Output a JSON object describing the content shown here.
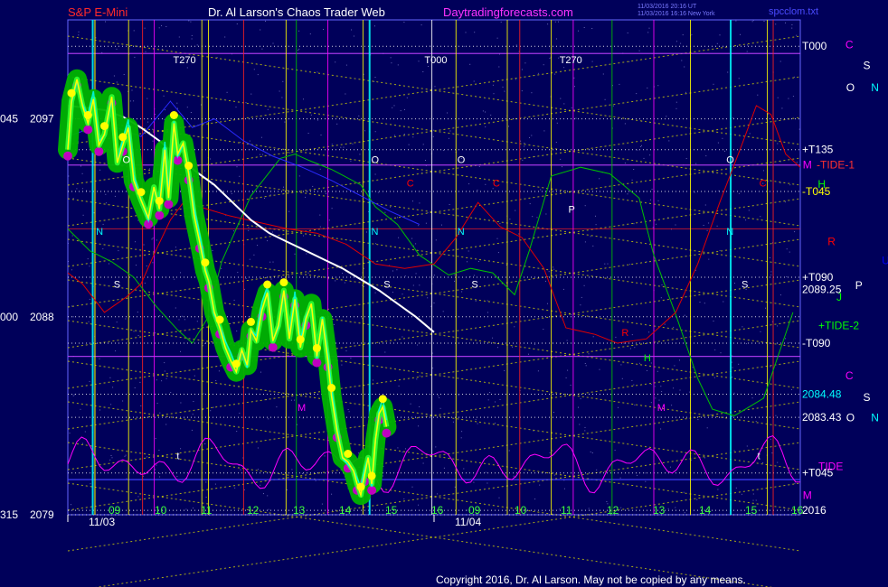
{
  "header": {
    "instrument": "S&P E-Mini",
    "site": "Dr. Al Larson's Chaos Trader Web",
    "link": "Daytradingforecasts.com",
    "timestamp_1": "11/03/2016 20:16 UT",
    "timestamp_2": "11/03/2016 16:16 New York",
    "filename": "spcclom.txt"
  },
  "footer": {
    "copyright": "Copyright 2016, Dr. Al Larson. May not be copied by any means."
  },
  "colors": {
    "background": "#00005a",
    "price": "#ffff00",
    "ribbon": "#00c800",
    "magenta": "#ff00ff",
    "cyan": "#00ffff",
    "white": "#ffffff",
    "red": "#e00000",
    "green": "#00c000"
  },
  "chart_data": {
    "type": "line",
    "title": "S&P E-Mini",
    "y_left_labels": [
      {
        "code": "045",
        "value": "2097"
      },
      {
        "code": "000",
        "value": "2088"
      },
      {
        "code": "315",
        "value": "2079"
      }
    ],
    "ylim": [
      2079,
      2101.5
    ],
    "x_dates": [
      "11/03",
      "11/04"
    ],
    "x_hours_day1": [
      "09",
      "10",
      "11",
      "12",
      "13",
      "14",
      "15",
      "16"
    ],
    "x_hours_day2": [
      "09",
      "10",
      "11",
      "12",
      "13",
      "14",
      "15",
      "16"
    ],
    "right_labels": [
      {
        "text": "T000",
        "value": 2100.3,
        "color": "#ffffff"
      },
      {
        "text": "+T135",
        "value": 2095.6,
        "color": "#ffffff"
      },
      {
        "text": "-TIDE-1",
        "value": 2094.9,
        "color": "#ff3030"
      },
      {
        "text": "-T045",
        "value": 2093.7,
        "color": "#ffff00"
      },
      {
        "text": "+T090",
        "value": 2089.8,
        "color": "#ffffff"
      },
      {
        "text": "2089.25",
        "value": 2089.25,
        "color": "#ffffff"
      },
      {
        "text": "+TIDE-2",
        "value": 2087.6,
        "color": "#00ff00"
      },
      {
        "text": "-T090",
        "value": 2086.8,
        "color": "#ffffff"
      },
      {
        "text": "2084.48",
        "value": 2084.48,
        "color": "#00ffff"
      },
      {
        "text": "2083.43",
        "value": 2083.43,
        "color": "#ffffff"
      },
      {
        "text": "+T045",
        "value": 2080.9,
        "color": "#ffffff"
      },
      {
        "text": "TIDE",
        "value": 2081.2,
        "color": "#ff00ff"
      },
      {
        "text": "2016",
        "value": 2079.2,
        "color": "#ffffff"
      }
    ],
    "planet_glyphs": [
      {
        "text": "C",
        "color": "#ff00ff",
        "fx": 0.952,
        "fy": 0.082
      },
      {
        "text": "S",
        "color": "#ffffff",
        "fx": 0.972,
        "fy": 0.118
      },
      {
        "text": "O",
        "color": "#ffffff",
        "fx": 0.953,
        "fy": 0.155
      },
      {
        "text": "N",
        "color": "#00ffff",
        "fx": 0.981,
        "fy": 0.155
      },
      {
        "text": "M",
        "color": "#ff00ff",
        "fx": 0.904,
        "fy": 0.287
      },
      {
        "text": "H",
        "color": "#00ff00",
        "fx": 0.921,
        "fy": 0.32
      },
      {
        "text": "R",
        "color": "#ff0000",
        "fx": 0.932,
        "fy": 0.418
      },
      {
        "text": "U",
        "color": "#0000ff",
        "fx": 0.993,
        "fy": 0.45
      },
      {
        "text": "P",
        "color": "#ffffff",
        "fx": 0.963,
        "fy": 0.492
      },
      {
        "text": "J",
        "color": "#00ff00",
        "fx": 0.942,
        "fy": 0.512
      },
      {
        "text": "C",
        "color": "#ff00ff",
        "fx": 0.952,
        "fy": 0.646
      },
      {
        "text": "S",
        "color": "#ffffff",
        "fx": 0.972,
        "fy": 0.683
      },
      {
        "text": "O",
        "color": "#ffffff",
        "fx": 0.953,
        "fy": 0.718
      },
      {
        "text": "N",
        "color": "#00ffff",
        "fx": 0.981,
        "fy": 0.718
      },
      {
        "text": "M",
        "color": "#ff00ff",
        "fx": 0.904,
        "fy": 0.85
      }
    ],
    "chart_markers": [
      {
        "text": "T270",
        "color": "#ffffff",
        "fx": 0.195,
        "fy": 0.108
      },
      {
        "text": "T000",
        "color": "#ffffff",
        "fx": 0.478,
        "fy": 0.108
      },
      {
        "text": "T270",
        "color": "#ffffff",
        "fx": 0.63,
        "fy": 0.108
      },
      {
        "text": "O",
        "color": "#ffffff",
        "fx": 0.418,
        "fy": 0.278
      },
      {
        "text": "O",
        "color": "#ffffff",
        "fx": 0.515,
        "fy": 0.278
      },
      {
        "text": "O",
        "color": "#ffffff",
        "fx": 0.818,
        "fy": 0.278
      },
      {
        "text": "O",
        "color": "#ffffff",
        "fx": 0.138,
        "fy": 0.278
      },
      {
        "text": "C",
        "color": "#ff0000",
        "fx": 0.458,
        "fy": 0.318
      },
      {
        "text": "C",
        "color": "#ff0000",
        "fx": 0.555,
        "fy": 0.318
      },
      {
        "text": "C",
        "color": "#ff0000",
        "fx": 0.855,
        "fy": 0.318
      },
      {
        "text": "P",
        "color": "#ffffff",
        "fx": 0.64,
        "fy": 0.362
      },
      {
        "text": "N",
        "color": "#00ffff",
        "fx": 0.108,
        "fy": 0.4
      },
      {
        "text": "N",
        "color": "#00ffff",
        "fx": 0.418,
        "fy": 0.4
      },
      {
        "text": "N",
        "color": "#00ffff",
        "fx": 0.515,
        "fy": 0.4
      },
      {
        "text": "N",
        "color": "#00ffff",
        "fx": 0.818,
        "fy": 0.4
      },
      {
        "text": "S",
        "color": "#ffffff",
        "fx": 0.128,
        "fy": 0.49
      },
      {
        "text": "S",
        "color": "#ffffff",
        "fx": 0.432,
        "fy": 0.49
      },
      {
        "text": "S",
        "color": "#ffffff",
        "fx": 0.531,
        "fy": 0.49
      },
      {
        "text": "S",
        "color": "#ffffff",
        "fx": 0.835,
        "fy": 0.49
      },
      {
        "text": "R",
        "color": "#ff0000",
        "fx": 0.7,
        "fy": 0.572
      },
      {
        "text": "H",
        "color": "#00ff00",
        "fx": 0.725,
        "fy": 0.615
      },
      {
        "text": "M",
        "color": "#ff00ff",
        "fx": 0.335,
        "fy": 0.7
      },
      {
        "text": "M",
        "color": "#ff00ff",
        "fx": 0.74,
        "fy": 0.7
      },
      {
        "text": "t",
        "color": "#ffffff",
        "fx": 0.199,
        "fy": 0.782
      },
      {
        "text": "t",
        "color": "#ffffff",
        "fx": 0.853,
        "fy": 0.782
      }
    ],
    "series": [
      {
        "name": "price",
        "values": [
          [
            0.0,
            2095.6
          ],
          [
            0.01,
            2097.8
          ],
          [
            0.025,
            2098.8
          ],
          [
            0.04,
            2097.6
          ],
          [
            0.055,
            2096.8
          ],
          [
            0.07,
            2097.9
          ],
          [
            0.085,
            2095.8
          ],
          [
            0.1,
            2096.3
          ],
          [
            0.12,
            2098.0
          ],
          [
            0.135,
            2095.0
          ],
          [
            0.15,
            2095.8
          ],
          [
            0.165,
            2096.6
          ],
          [
            0.18,
            2094.2
          ],
          [
            0.2,
            2093.3
          ],
          [
            0.22,
            2092.5
          ],
          [
            0.235,
            2093.9
          ],
          [
            0.25,
            2092.9
          ],
          [
            0.265,
            2095.6
          ],
          [
            0.275,
            2093.4
          ],
          [
            0.29,
            2096.8
          ],
          [
            0.3,
            2095.4
          ],
          [
            0.315,
            2095.9
          ],
          [
            0.33,
            2094.5
          ],
          [
            0.345,
            2092.6
          ],
          [
            0.36,
            2091.4
          ],
          [
            0.375,
            2090.1
          ],
          [
            0.385,
            2089.6
          ],
          [
            0.4,
            2088.2
          ],
          [
            0.415,
            2087.5
          ],
          [
            0.43,
            2086.6
          ],
          [
            0.445,
            2086.0
          ],
          [
            0.46,
            2085.5
          ],
          [
            0.475,
            2086.5
          ],
          [
            0.49,
            2085.8
          ],
          [
            0.5,
            2087.4
          ],
          [
            0.515,
            2086.9
          ],
          [
            0.53,
            2088.3
          ],
          [
            0.545,
            2089.1
          ],
          [
            0.56,
            2086.9
          ],
          [
            0.575,
            2087.6
          ],
          [
            0.59,
            2089.2
          ],
          [
            0.605,
            2087.0
          ],
          [
            0.62,
            2088.8
          ],
          [
            0.635,
            2086.6
          ],
          [
            0.65,
            2087.9
          ],
          [
            0.665,
            2088.6
          ],
          [
            0.68,
            2086.2
          ],
          [
            0.695,
            2087.9
          ],
          [
            0.71,
            2086.0
          ],
          [
            0.72,
            2084.4
          ],
          [
            0.735,
            2082.8
          ],
          [
            0.75,
            2081.6
          ],
          [
            0.765,
            2081.4
          ],
          [
            0.78,
            2081.0
          ],
          [
            0.79,
            2080.4
          ],
          [
            0.8,
            2079.9
          ],
          [
            0.81,
            2080.8
          ],
          [
            0.82,
            2081.6
          ],
          [
            0.83,
            2080.4
          ],
          [
            0.84,
            2082.4
          ],
          [
            0.85,
            2083.6
          ],
          [
            0.86,
            2083.9
          ],
          [
            0.87,
            2083.0
          ]
        ]
      },
      {
        "name": "forecast",
        "values": [
          [
            0.0,
            2097.6
          ],
          [
            0.05,
            2097.5
          ],
          [
            0.1,
            2097.4
          ],
          [
            0.15,
            2097.1
          ],
          [
            0.2,
            2096.6
          ],
          [
            0.25,
            2096.0
          ],
          [
            0.3,
            2095.3
          ],
          [
            0.35,
            2094.6
          ],
          [
            0.4,
            2094.0
          ],
          [
            0.45,
            2093.2
          ],
          [
            0.5,
            2092.4
          ],
          [
            0.55,
            2091.8
          ],
          [
            0.6,
            2091.4
          ],
          [
            0.65,
            2091.0
          ],
          [
            0.7,
            2090.6
          ],
          [
            0.75,
            2090.2
          ],
          [
            0.8,
            2089.7
          ],
          [
            0.85,
            2089.2
          ],
          [
            0.9,
            2088.6
          ],
          [
            0.95,
            2088.0
          ],
          [
            1.0,
            2087.3
          ]
        ]
      }
    ]
  }
}
